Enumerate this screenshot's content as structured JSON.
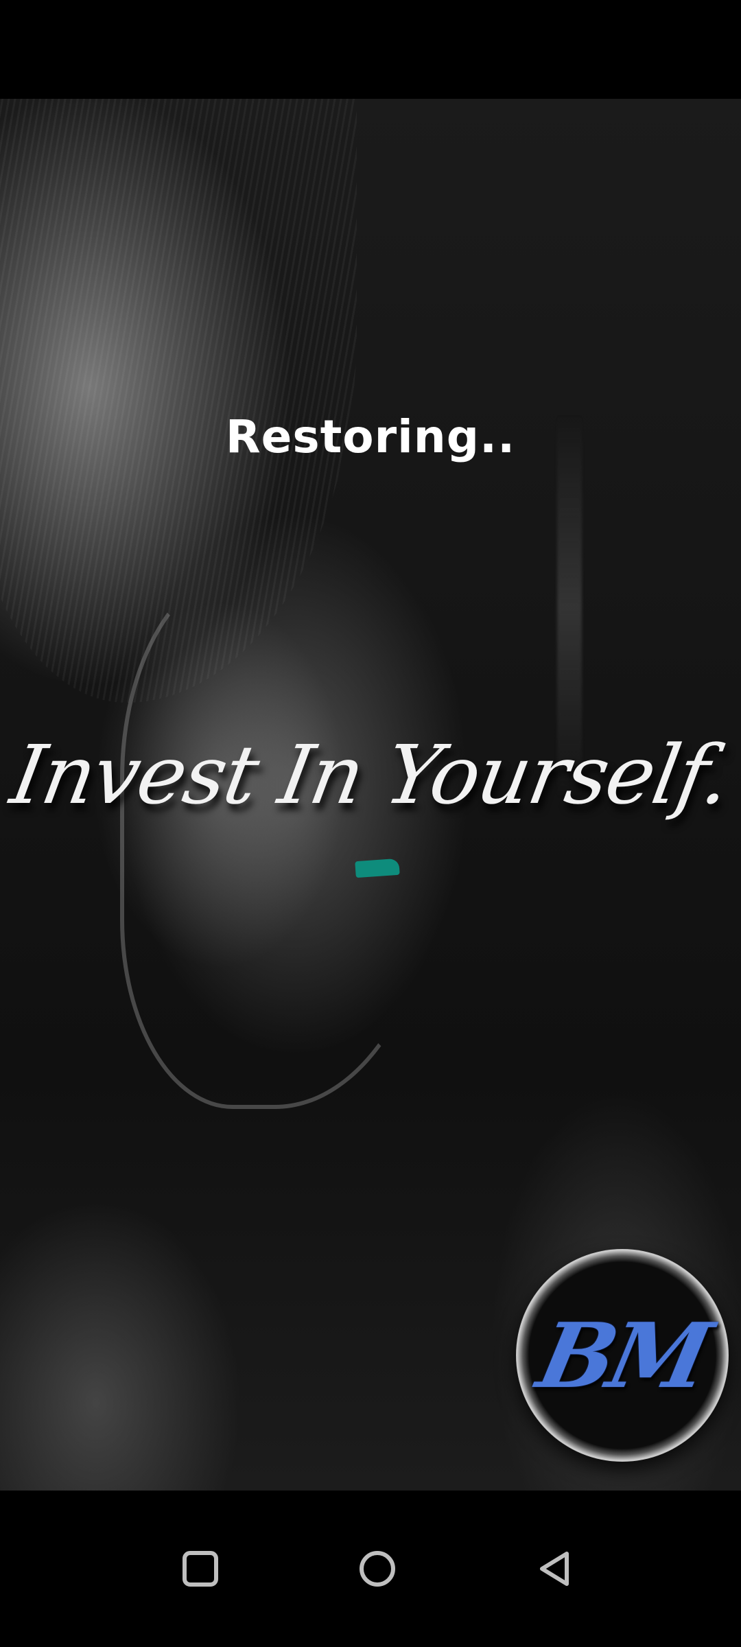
{
  "status_text": "Restoring..",
  "tagline": "Invest In Yourself.",
  "logo": {
    "text": "BM",
    "color": "#4a77d9"
  },
  "loading_indicator": {
    "color": "#0e8c7c"
  },
  "navigation": {
    "recents_icon": "square-icon",
    "home_icon": "circle-icon",
    "back_icon": "triangle-back-icon",
    "icon_color": "#bfbfbf"
  }
}
